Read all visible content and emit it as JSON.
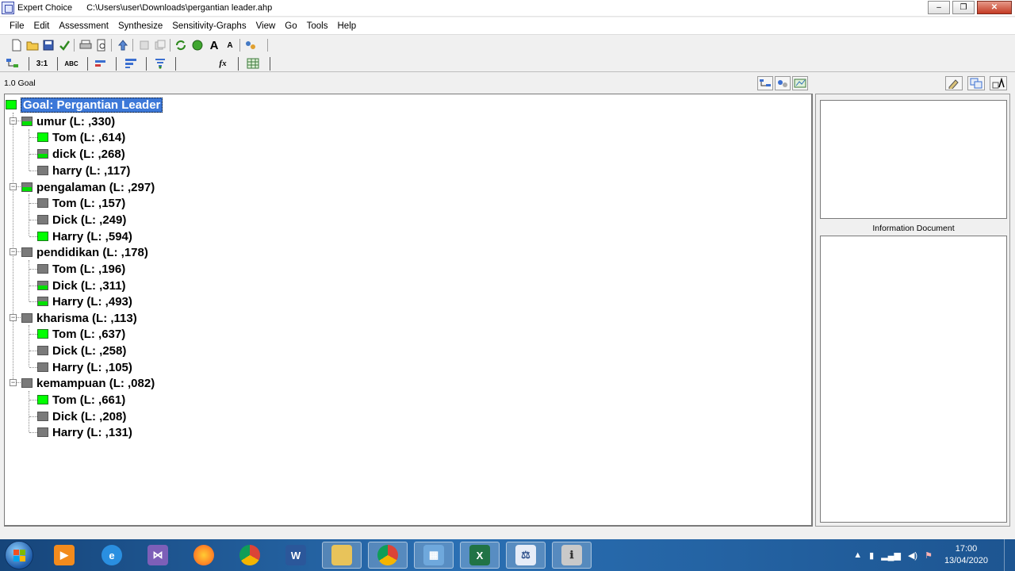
{
  "window": {
    "app_name": "Expert Choice",
    "file_path": "C:\\Users\\user\\Downloads\\pergantian leader.ahp",
    "minimize_label": "–",
    "maximize_label": "❐",
    "close_label": "✕"
  },
  "menu": [
    {
      "label": "File"
    },
    {
      "label": "Edit"
    },
    {
      "label": "Assessment"
    },
    {
      "label": "Synthesize"
    },
    {
      "label": "Sensitivity-Graphs"
    },
    {
      "label": "View"
    },
    {
      "label": "Go"
    },
    {
      "label": "Tools"
    },
    {
      "label": "Help"
    }
  ],
  "toolbar2": {
    "ratio_label": "3:1",
    "abc_label": "ABC",
    "fx_label": "fx",
    "font_large_label": "A",
    "font_small_label": "A"
  },
  "main": {
    "node_path": "1.0 Goal",
    "goal": "Goal: Pergantian Leader",
    "criteria": [
      {
        "label": "umur (L: ,330)",
        "alternatives": [
          "Tom (L: ,614)",
          "dick (L: ,268)",
          "harry (L: ,117)"
        ]
      },
      {
        "label": "pengalaman (L: ,297)",
        "alternatives": [
          "Tom (L: ,157)",
          "Dick (L: ,249)",
          "Harry (L: ,594)"
        ]
      },
      {
        "label": "pendidikan (L: ,178)",
        "alternatives": [
          "Tom (L: ,196)",
          "Dick (L: ,311)",
          "Harry (L: ,493)"
        ]
      },
      {
        "label": "kharisma (L: ,113)",
        "alternatives": [
          "Tom (L: ,637)",
          "Dick (L: ,258)",
          "Harry (L: ,105)"
        ]
      },
      {
        "label": "kemampuan (L: ,082)",
        "alternatives": [
          "Tom (L: ,661)",
          "Dick (L: ,208)",
          "Harry (L: ,131)"
        ]
      }
    ]
  },
  "right_pane": {
    "info_label": "Information Document"
  },
  "taskbar": {
    "time": "17:00",
    "date": "13/04/2020"
  },
  "colors": {
    "priority_high": "#00ff00",
    "priority_low": "#7a7a7a",
    "selection": "#3c78d8"
  }
}
